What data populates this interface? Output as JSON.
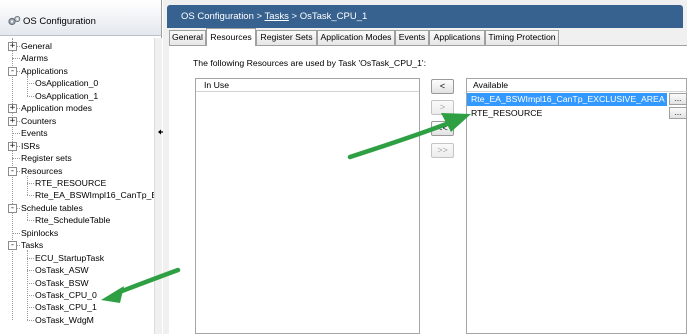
{
  "left_panel": {
    "title": "OS Configuration",
    "tree": [
      {
        "label": "General",
        "expander": "+"
      },
      {
        "label": "Alarms"
      },
      {
        "label": "Applications",
        "expander": "-"
      },
      {
        "label": "OsApplication_0"
      },
      {
        "label": "OsApplication_1"
      },
      {
        "label": "Application modes",
        "expander": "+"
      },
      {
        "label": "Counters",
        "expander": "+"
      },
      {
        "label": "Events"
      },
      {
        "label": "ISRs",
        "expander": "+"
      },
      {
        "label": "Register sets"
      },
      {
        "label": "Resources",
        "expander": "-"
      },
      {
        "label": "RTE_RESOURCE"
      },
      {
        "label": "Rte_EA_BSWImpl16_CanTp_EX"
      },
      {
        "label": "Schedule tables",
        "expander": "-"
      },
      {
        "label": "Rte_ScheduleTable"
      },
      {
        "label": "Spinlocks"
      },
      {
        "label": "Tasks",
        "expander": "-"
      },
      {
        "label": "ECU_StartupTask"
      },
      {
        "label": "OsTask_ASW"
      },
      {
        "label": "OsTask_BSW"
      },
      {
        "label": "OsTask_CPU_0"
      },
      {
        "label": "OsTask_CPU_1"
      },
      {
        "label": "OsTask_WdgM"
      }
    ]
  },
  "breadcrumb": {
    "root": "OS Configuration",
    "sep1": ">",
    "link": "Tasks",
    "sep2": ">",
    "current": "OsTask_CPU_1"
  },
  "tabs": [
    "General",
    "Resources",
    "Register Sets",
    "Application Modes",
    "Events",
    "Applications",
    "Timing Protection"
  ],
  "active_tab": "Resources",
  "resources_tab": {
    "description": "The following Resources are used by Task 'OsTask_CPU_1':",
    "in_use_header": "In Use",
    "available_header": "Available",
    "buttons": {
      "add_one": "<",
      "remove_one": ">",
      "add_all": "<<",
      "remove_all": ">>"
    },
    "available_items": [
      {
        "label": "Rte_EA_BSWImpl16_CanTp_EXCLUSIVE_AREA",
        "selected": true,
        "button": "..."
      },
      {
        "label": "RTE_RESOURCE",
        "selected": false,
        "button": "..."
      }
    ]
  },
  "colors": {
    "breadcrumb_bar": "#37628f",
    "selection": "#3399ff",
    "annotation_arrow": "#2ea043"
  }
}
